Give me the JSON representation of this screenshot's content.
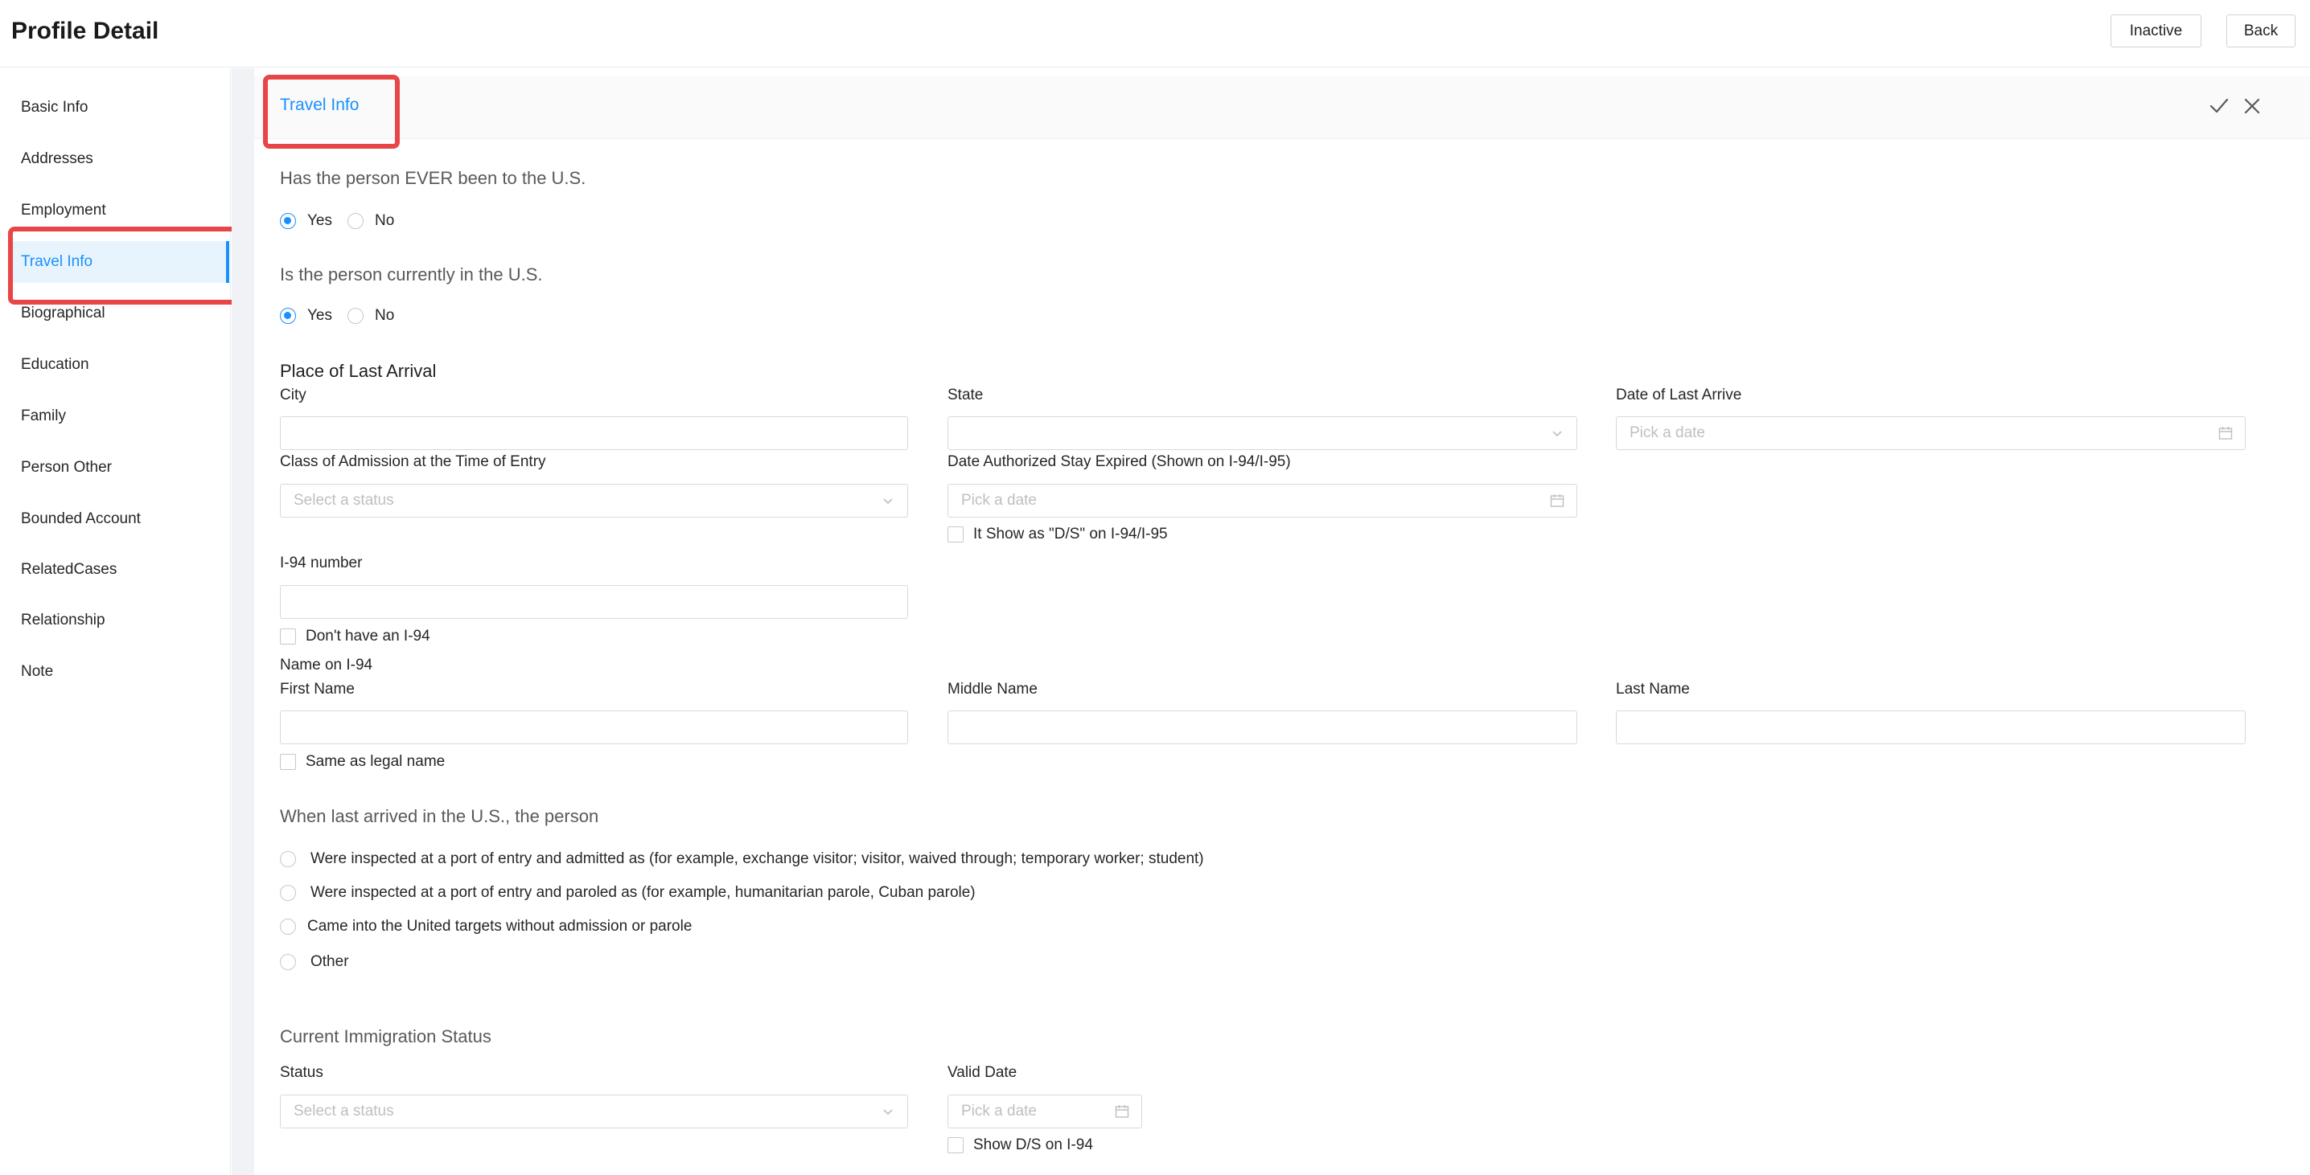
{
  "header": {
    "title": "Profile Detail",
    "inactive_label": "Inactive",
    "back_label": "Back"
  },
  "sidebar": {
    "items": [
      {
        "label": "Basic Info"
      },
      {
        "label": "Addresses"
      },
      {
        "label": "Employment"
      },
      {
        "label": "Travel Info"
      },
      {
        "label": "Biographical"
      },
      {
        "label": "Education"
      },
      {
        "label": "Family"
      },
      {
        "label": "Person Other"
      },
      {
        "label": "Bounded Account"
      },
      {
        "label": "RelatedCases"
      },
      {
        "label": "Relationship"
      },
      {
        "label": "Note"
      }
    ],
    "active": "Travel Info"
  },
  "panel": {
    "title": "Travel Info",
    "icons": [
      "check-icon",
      "close-icon"
    ]
  },
  "form": {
    "ever_in_us": {
      "question": "Has the person EVER been to the U.S.",
      "yes": "Yes",
      "no": "No",
      "selected": "Yes"
    },
    "currently_in_us": {
      "question": "Is the person currently in the U.S.",
      "yes": "Yes",
      "no": "No",
      "selected": "Yes"
    },
    "last_arrival": {
      "heading": "Place of Last Arrival",
      "city_label": "City",
      "city_value": "",
      "state_label": "State",
      "state_value": "",
      "date_label": "Date of Last Arrive",
      "date_placeholder": "Pick a date"
    },
    "class_of_admission": {
      "label": "Class of Admission at the Time of Entry",
      "placeholder": "Select a status"
    },
    "stay_expired": {
      "label": "Date Authorized Stay Expired (Shown on I-94/I-95)",
      "placeholder": "Pick a date",
      "checkbox_label": "It Show as \"D/S\" on I-94/I-95"
    },
    "i94": {
      "label": "I-94 number",
      "value": "",
      "no_i94_label": "Don't have an I-94",
      "name_heading": "Name on I-94",
      "first_name_label": "First Name",
      "middle_name_label": "Middle Name",
      "last_name_label": "Last Name",
      "same_as_legal_label": "Same as legal name"
    },
    "last_arrived": {
      "question": "When last arrived in the U.S., the person",
      "options": [
        "Were inspected at a port of entry and admitted as (for example, exchange visitor; visitor, waived through; temporary worker; student)",
        "Were inspected at a port of entry and paroled as (for example, humanitarian parole, Cuban parole)",
        "Came into the United targets without admission or parole",
        "Other"
      ]
    },
    "current_status": {
      "heading": "Current Immigration Status",
      "status_label": "Status",
      "status_placeholder": "Select a status",
      "valid_date_label": "Valid Date",
      "valid_date_placeholder": "Pick a date",
      "show_ds_label": "Show D/S on I-94"
    }
  },
  "colors": {
    "accent": "#1890ff",
    "highlight": "#e84646",
    "sidebar_active_bg": "#e8f4fd"
  }
}
